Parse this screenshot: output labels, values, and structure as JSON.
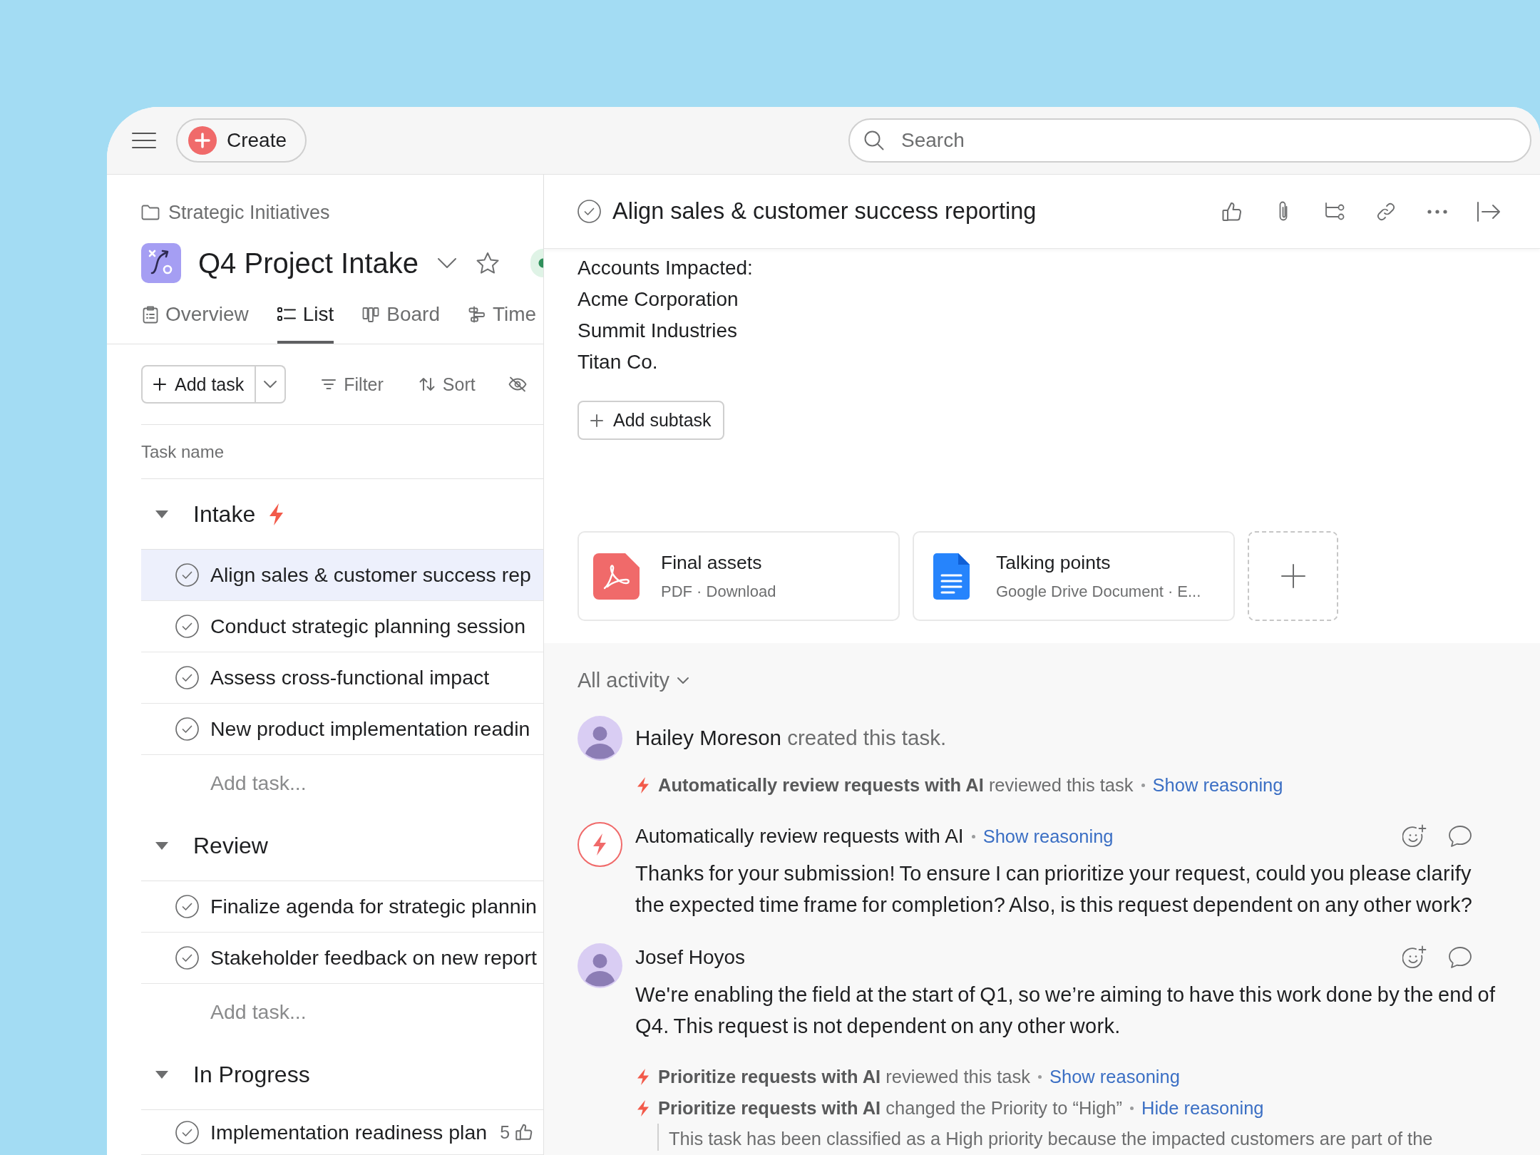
{
  "topbar": {
    "create": "Create",
    "search": {
      "placeholder": "Search"
    }
  },
  "project": {
    "breadcrumb": "Strategic Initiatives",
    "title": "Q4 Project Intake",
    "tabs": [
      {
        "kind": "overview",
        "label": "Overview",
        "selected": false
      },
      {
        "kind": "list",
        "label": "List",
        "selected": true
      },
      {
        "kind": "board",
        "label": "Board",
        "selected": false
      },
      {
        "kind": "timeline",
        "label": "Time",
        "selected": false
      }
    ]
  },
  "toolbar": {
    "add_task": "Add task",
    "actions": [
      {
        "kind": "filter",
        "label": "Filter"
      },
      {
        "kind": "sort",
        "label": "Sort"
      },
      {
        "kind": "hide"
      }
    ]
  },
  "task_list": {
    "column": "Task name",
    "sections": [
      {
        "name": "Intake",
        "ai": true,
        "expanded": true,
        "tasks": [
          {
            "name": "Align sales & customer success rep",
            "selected": true
          },
          {
            "name": "Conduct strategic planning session",
            "selected": false
          },
          {
            "name": "Assess cross-functional impact",
            "selected": false
          },
          {
            "name": "New product implementation readin",
            "selected": false
          }
        ],
        "add_task": "Add task..."
      },
      {
        "name": "Review",
        "ai": false,
        "expanded": true,
        "tasks": [
          {
            "name": "Finalize agenda for strategic plannin",
            "selected": false
          },
          {
            "name": "Stakeholder feedback on new report",
            "selected": false
          }
        ],
        "add_task": "Add task..."
      },
      {
        "name": "In Progress",
        "ai": false,
        "expanded": true,
        "tasks": [
          {
            "name": "Implementation readiness plan",
            "selected": false,
            "likes": "5"
          }
        ]
      }
    ]
  },
  "detail": {
    "title": "Align sales & customer success reporting",
    "description": [
      "Accounts Impacted:",
      "Acme Corporation",
      "Summit Industries",
      "Titan Co."
    ],
    "add_subtask": "Add subtask",
    "attachments": [
      {
        "kind": "pdf",
        "name": "Final assets",
        "meta": "PDF · Download"
      },
      {
        "kind": "doc",
        "name": "Talking points",
        "meta": "Google Drive Document · E..."
      }
    ]
  },
  "activity": {
    "filter": "All activity",
    "items": [
      {
        "kind": "event",
        "author": "Hailey Moreson",
        "text": "created this task."
      },
      {
        "kind": "ai_event",
        "actor": "Automatically review requests with AI",
        "text": "reviewed this task",
        "link": "Show reasoning"
      },
      {
        "kind": "ai_comment",
        "author": "Automatically review requests with AI",
        "link": "Show reasoning",
        "body": "Thanks for your submission! To ensure I can prioritize your request, could you please clarify the expected time frame for completion? Also, is this request dependent on any other work?"
      },
      {
        "kind": "comment",
        "author": "Josef Hoyos",
        "body": "We're enabling the field at the start of Q1, so we’re aiming to have this work done by the end of Q4. This request is not dependent on any other work."
      },
      {
        "kind": "ai_event",
        "actor": "Prioritize requests with AI",
        "text": "reviewed this task",
        "link": "Show reasoning"
      },
      {
        "kind": "ai_event",
        "actor": "Prioritize requests with AI",
        "text": "changed the Priority to “High”",
        "link": "Hide reasoning",
        "reasoning": "This task has been classified as a High priority because the impacted customers are part of the"
      }
    ]
  }
}
